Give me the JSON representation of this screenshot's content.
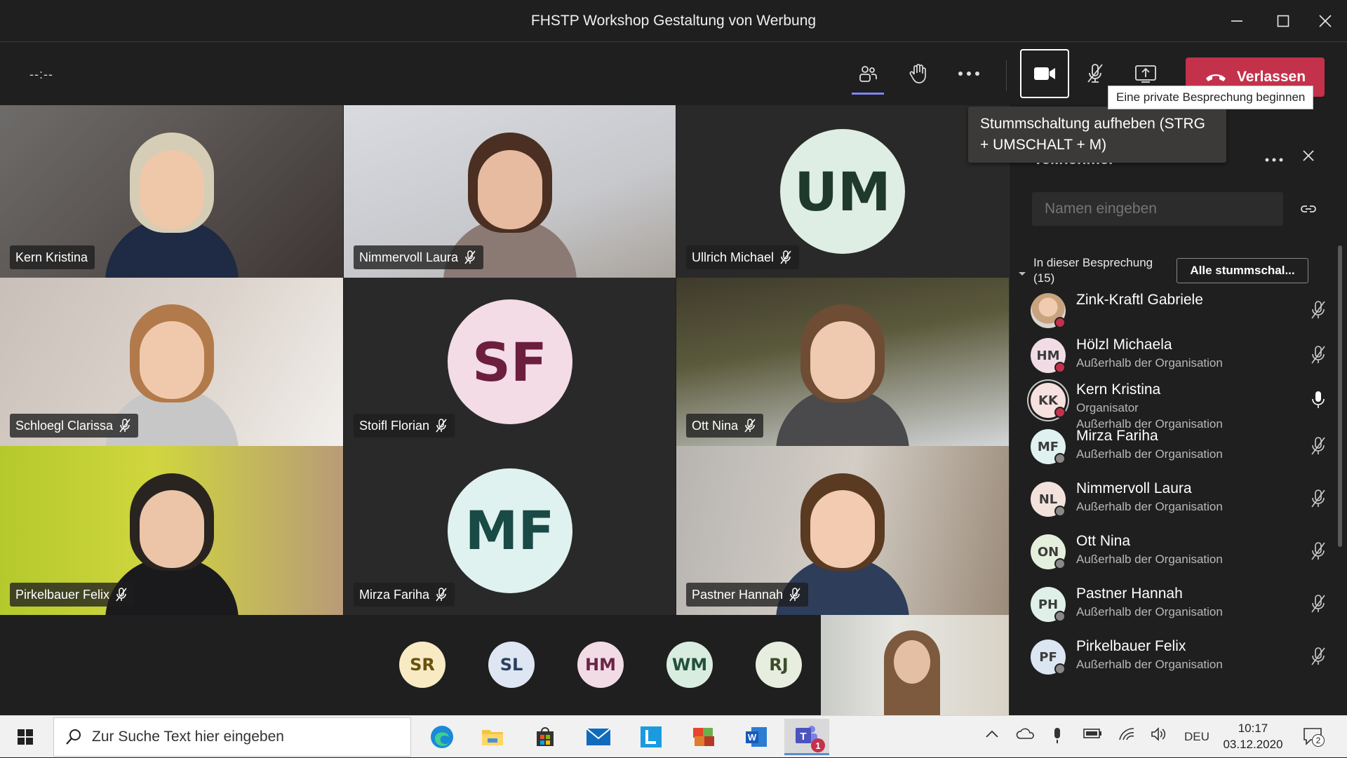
{
  "window": {
    "title": "FHSTP Workshop Gestaltung von Werbung"
  },
  "callbar": {
    "timer": "--:--",
    "leave_label": "Verlassen"
  },
  "tooltips": {
    "private_meeting": "Eine private Besprechung beginnen",
    "unmute": "Stummschaltung aufheben (STRG + UMSCHALT + M)"
  },
  "tiles": [
    {
      "name": "Kern Kristina",
      "muted": false,
      "type": "video"
    },
    {
      "name": "Nimmervoll Laura",
      "muted": true,
      "type": "video"
    },
    {
      "name": "Ullrich Michael",
      "muted": true,
      "type": "avatar",
      "initials": "UM",
      "color": "#dfeee4",
      "text_color": "#1f3a2c"
    },
    {
      "name": "Schloegl Clarissa",
      "muted": true,
      "type": "video"
    },
    {
      "name": "Stoifl Florian",
      "muted": true,
      "type": "avatar",
      "initials": "SF",
      "color": "#f3dce6",
      "text_color": "#6b1f3c"
    },
    {
      "name": "Ott Nina",
      "muted": true,
      "type": "video"
    },
    {
      "name": "Pirkelbauer Felix",
      "muted": true,
      "type": "video"
    },
    {
      "name": "Mirza Fariha",
      "muted": true,
      "type": "avatar",
      "initials": "MF",
      "color": "#dff2ef",
      "text_color": "#1a4a45"
    },
    {
      "name": "Pastner Hannah",
      "muted": true,
      "type": "video"
    }
  ],
  "overflow": [
    {
      "initials": "SR",
      "color": "#f8ebc4",
      "text_color": "#6a5010"
    },
    {
      "initials": "SL",
      "color": "#dde6f2",
      "text_color": "#2c3f5e"
    },
    {
      "initials": "HM",
      "color": "#f1dce6",
      "text_color": "#6b2444"
    },
    {
      "initials": "WM",
      "color": "#d9ece0",
      "text_color": "#23513a"
    },
    {
      "initials": "RJ",
      "color": "#e7eedf",
      "text_color": "#3d4d2a"
    }
  ],
  "panel": {
    "title": "Teilnehmer",
    "search_placeholder": "Namen eingeben",
    "section_label": "In dieser Besprechung",
    "section_count": "(15)",
    "mute_all_label": "Alle stummschal...",
    "participants": [
      {
        "initials": "",
        "name": "Zink-Kraftl Gabriele",
        "sub1": "",
        "sub2": "",
        "muted": true,
        "photo": true,
        "status": "#c4314b"
      },
      {
        "initials": "HM",
        "name": "Hölzl Michaela",
        "sub1": "Außerhalb der Organisation",
        "sub2": "",
        "muted": true,
        "color": "#f1dce6",
        "status": "#c4314b"
      },
      {
        "initials": "KK",
        "name": "Kern Kristina",
        "sub1": "Organisator",
        "sub2": "Außerhalb der Organisation",
        "muted": false,
        "color": "#f7e0e0",
        "status": "#c4314b"
      },
      {
        "initials": "MF",
        "name": "Mirza Fariha",
        "sub1": "Außerhalb der Organisation",
        "sub2": "",
        "muted": true,
        "color": "#dff2ef",
        "status": "#8a8886"
      },
      {
        "initials": "NL",
        "name": "Nimmervoll Laura",
        "sub1": "Außerhalb der Organisation",
        "sub2": "",
        "muted": true,
        "color": "#f3e2dc",
        "status": "#8a8886"
      },
      {
        "initials": "ON",
        "name": "Ott Nina",
        "sub1": "Außerhalb der Organisation",
        "sub2": "",
        "muted": true,
        "color": "#e5f0dc",
        "status": "#8a8886"
      },
      {
        "initials": "PH",
        "name": "Pastner Hannah",
        "sub1": "Außerhalb der Organisation",
        "sub2": "",
        "muted": true,
        "color": "#dff0e8",
        "status": "#8a8886"
      },
      {
        "initials": "PF",
        "name": "Pirkelbauer Felix",
        "sub1": "Außerhalb der Organisation",
        "sub2": "",
        "muted": true,
        "color": "#dce6f2",
        "status": "#8a8886"
      }
    ]
  },
  "taskbar": {
    "search_placeholder": "Zur Suche Text hier eingeben",
    "language": "DEU",
    "time": "10:17",
    "date": "03.12.2020",
    "notification_count": "2",
    "teams_badge": "1"
  }
}
